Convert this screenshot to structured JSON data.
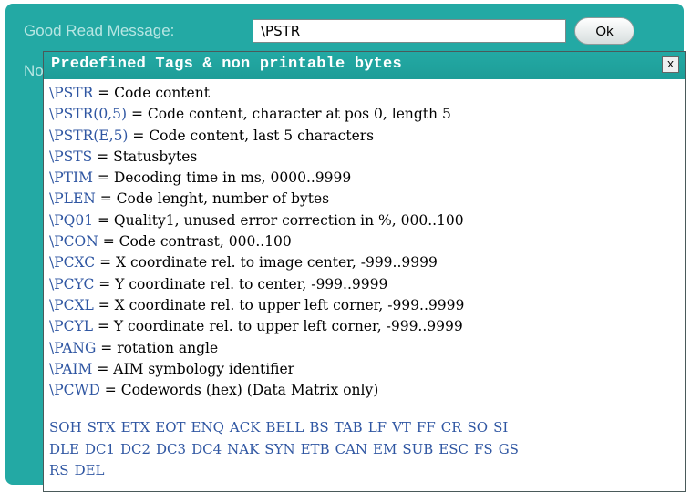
{
  "form": {
    "good_read_label": "Good Read Message:",
    "good_read_value": "\\PSTR",
    "ok_label": "Ok",
    "behind_label": "No"
  },
  "popup": {
    "title": "Predefined Tags & non printable bytes",
    "close_label": "x",
    "tags": [
      {
        "code": "\\PSTR",
        "desc": " = Code content"
      },
      {
        "code": "\\PSTR(0,5)",
        "desc": " = Code content, character at pos 0, length 5"
      },
      {
        "code": "\\PSTR(E,5)",
        "desc": " = Code content, last 5 characters"
      },
      {
        "code": "\\PSTS",
        "desc": " = Statusbytes"
      },
      {
        "code": "\\PTIM",
        "desc": " = Decoding time in ms, 0000..9999"
      },
      {
        "code": "\\PLEN",
        "desc": " = Code lenght, number of bytes"
      },
      {
        "code": "\\PQ01",
        "desc": " = Quality1, unused error correction in %, 000..100"
      },
      {
        "code": "\\PCON",
        "desc": " = Code contrast, 000..100"
      },
      {
        "code": "\\PCXC",
        "desc": " = X coordinate rel. to image center, -999..9999"
      },
      {
        "code": "\\PCYC",
        "desc": " = Y coordinate rel. to center, -999..9999"
      },
      {
        "code": "\\PCXL",
        "desc": " = X coordinate rel. to upper left corner, -999..9999"
      },
      {
        "code": "\\PCYL",
        "desc": " = Y coordinate rel. to upper left corner, -999..9999"
      },
      {
        "code": "\\PANG",
        "desc": " = rotation angle"
      },
      {
        "code": "\\PAIM",
        "desc": " = AIM symbology identifier"
      },
      {
        "code": "\\PCWD",
        "desc": " = Codewords (hex) (Data Matrix only)"
      }
    ],
    "bytes": [
      [
        "SOH",
        "STX",
        "ETX",
        "EOT",
        "ENQ",
        "ACK",
        "BELL",
        "BS",
        "TAB",
        "LF",
        "VT",
        "FF",
        "CR",
        "SO",
        "SI"
      ],
      [
        "DLE",
        "DC1",
        "DC2",
        "DC3",
        "DC4",
        "NAK",
        "SYN",
        "ETB",
        "CAN",
        "EM",
        "SUB",
        "ESC",
        "FS",
        "GS"
      ],
      [
        "RS",
        "DEL"
      ]
    ]
  }
}
